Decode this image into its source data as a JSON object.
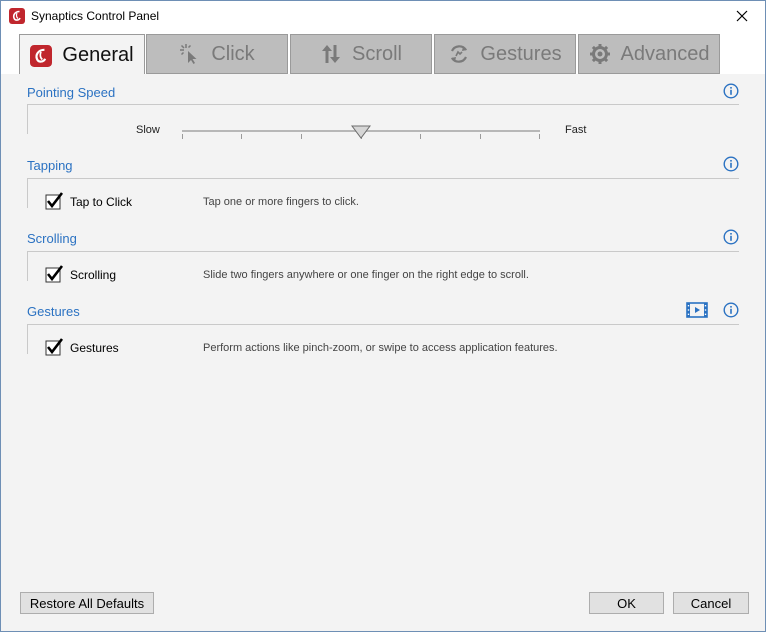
{
  "window": {
    "title": "Synaptics Control Panel"
  },
  "tabs": [
    {
      "label": "General",
      "icon": "synaptics-logo-icon",
      "active": true
    },
    {
      "label": "Click",
      "icon": "click-pointer-icon",
      "active": false
    },
    {
      "label": "Scroll",
      "icon": "scroll-arrows-icon",
      "active": false
    },
    {
      "label": "Gestures",
      "icon": "gestures-icon",
      "active": false
    },
    {
      "label": "Advanced",
      "icon": "gear-icon",
      "active": false
    }
  ],
  "pointing_speed": {
    "title": "Pointing Speed",
    "min_label": "Slow",
    "max_label": "Fast",
    "value_fraction": 0.5
  },
  "tapping": {
    "title": "Tapping",
    "label": "Tap to Click",
    "description": "Tap one or more fingers to click.",
    "checked": true
  },
  "scrolling": {
    "title": "Scrolling",
    "label": "Scrolling",
    "description": "Slide two fingers anywhere or one finger on the right edge to scroll.",
    "checked": true
  },
  "gestures": {
    "title": "Gestures",
    "label": "Gestures",
    "description": "Perform actions like pinch-zoom, or swipe to access application features.",
    "checked": true
  },
  "buttons": {
    "restore": "Restore All Defaults",
    "ok": "OK",
    "cancel": "Cancel"
  },
  "colors": {
    "accent": "#2b72c2",
    "logo_red": "#c0262d",
    "tab_inactive": "#bdbdbd",
    "content_bg": "#f3f3f3"
  }
}
